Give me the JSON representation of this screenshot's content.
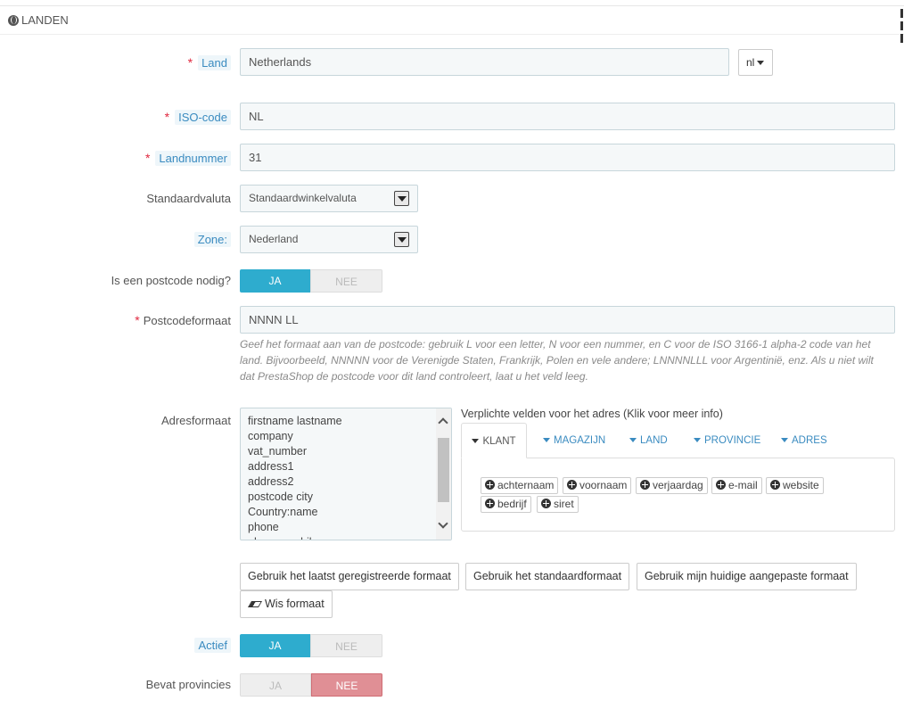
{
  "header": {
    "title": "LANDEN",
    "icon": "globe-icon"
  },
  "fields": {
    "land": {
      "label": "Land",
      "value": "Netherlands",
      "lang": "nl"
    },
    "iso": {
      "label": "ISO-code",
      "value": "NL"
    },
    "landnummer": {
      "label": "Landnummer",
      "value": "31"
    },
    "valuta": {
      "label": "Standaardvaluta",
      "value": "Standaardwinkelvaluta"
    },
    "zone": {
      "label": "Zone:",
      "value": "Nederland"
    },
    "postcode_nodig": {
      "label": "Is een postcode nodig?",
      "yes": "JA",
      "no": "NEE"
    },
    "postcodeformaat": {
      "label": "Postcodeformaat",
      "value": "NNNN LL",
      "help": "Geef het formaat aan van de postcode: gebruik L voor een letter, N voor een nummer, en C voor de ISO 3166-1 alpha-2 code van het land. Bijvoorbeeld, NNNNN voor de Verenigde Staten, Frankrijk, Polen en vele andere; LNNNNLLL voor Argentinië, enz. Als u niet wilt dat PrestaShop de postcode voor dit land controleert, laat u het veld leeg."
    },
    "adresformaat": {
      "label": "Adresformaat",
      "lines": [
        "firstname lastname",
        "company",
        "vat_number",
        "address1",
        "address2",
        "postcode city",
        "Country:name",
        "phone",
        "phone_mobile"
      ]
    },
    "actief": {
      "label": "Actief",
      "yes": "JA",
      "no": "NEE"
    },
    "provincies": {
      "label": "Bevat provincies",
      "yes": "JA",
      "no": "NEE"
    }
  },
  "required_fields": {
    "title": "Verplichte velden voor het adres (Klik voor meer info)",
    "tabs": [
      "KLANT",
      "MAGAZIJN",
      "LAND",
      "PROVINCIE",
      "ADRES"
    ],
    "chips": [
      "achternaam",
      "voornaam",
      "verjaardag",
      "e-mail",
      "website",
      "bedrijf",
      "siret"
    ]
  },
  "buttons": {
    "last_format": "Gebruik het laatst geregistreerde formaat",
    "default_format": "Gebruik het standaardformaat",
    "custom_format": "Gebruik mijn huidige aangepaste formaat",
    "clear_format": "Wis formaat"
  },
  "colors": {
    "primary": "#2eacce",
    "danger": "#e08f95",
    "link": "#3a8bc0",
    "required": "#e0283f"
  }
}
